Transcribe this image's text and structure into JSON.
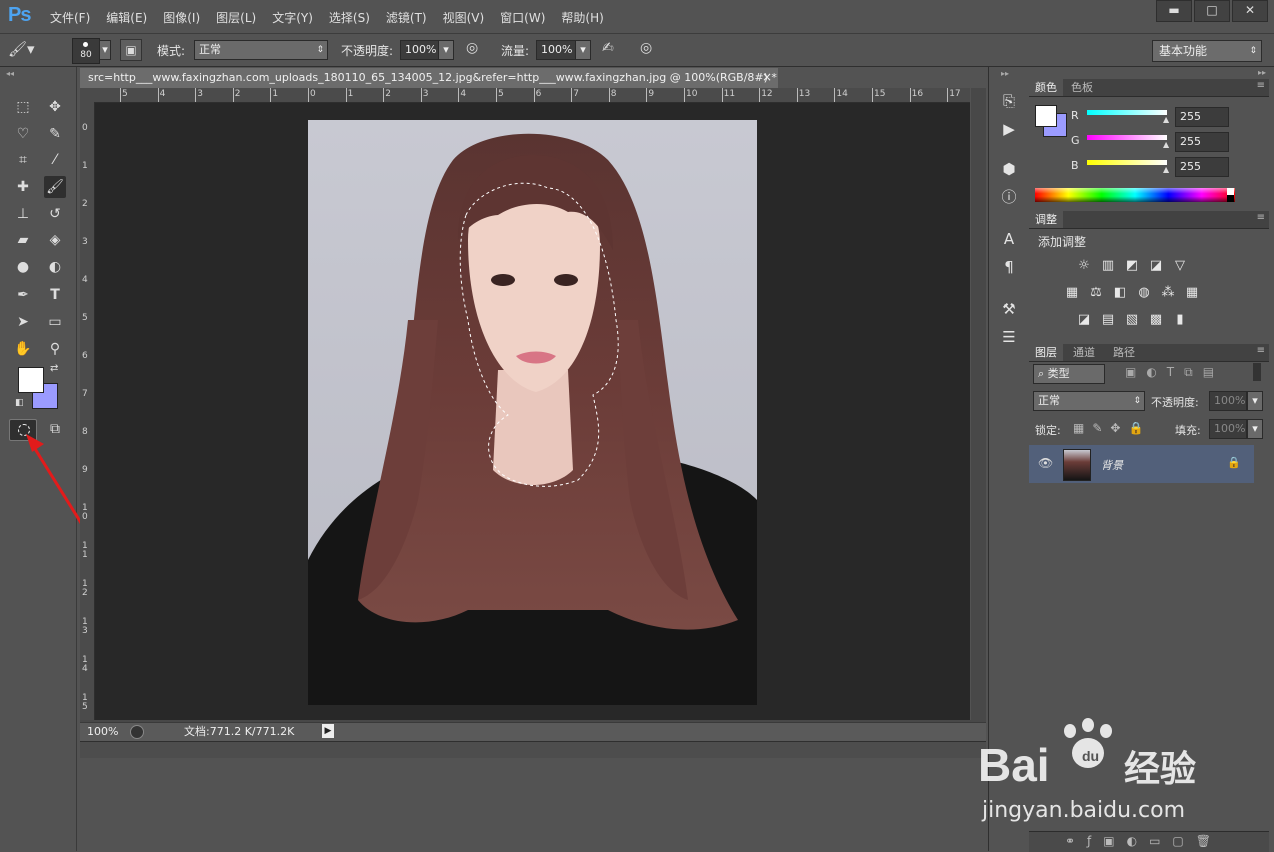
{
  "app": {
    "logo": "Ps"
  },
  "menu": [
    "文件(F)",
    "编辑(E)",
    "图像(I)",
    "图层(L)",
    "文字(Y)",
    "选择(S)",
    "滤镜(T)",
    "视图(V)",
    "窗口(W)",
    "帮助(H)"
  ],
  "window_buttons": {
    "minimize": "▬",
    "maximize": "□",
    "close": "✕"
  },
  "options": {
    "brush_size": "80",
    "mode_label": "模式:",
    "mode_value": "正常",
    "opacity_label": "不透明度:",
    "opacity_value": "100%",
    "flow_label": "流量:",
    "flow_value": "100%",
    "workspace": "基本功能"
  },
  "document": {
    "tab_title": "src=http___www.faxingzhan.com_uploads_180110_65_134005_12.jpg&refer=http___www.faxingzhan.jpg @ 100%(RGB/8#) *",
    "close": "×",
    "ruler_top": [
      "5",
      "4",
      "3",
      "2",
      "1",
      "0",
      "1",
      "2",
      "3",
      "4",
      "5",
      "6",
      "7",
      "8",
      "9",
      "10",
      "11",
      "12",
      "13",
      "14",
      "15",
      "16",
      "17"
    ],
    "ruler_left": [
      "0",
      "1",
      "2",
      "3",
      "4",
      "5",
      "6",
      "7",
      "8",
      "9",
      "1\n0",
      "1\n1",
      "1\n2",
      "1\n3",
      "1\n4",
      "1\n5"
    ],
    "zoom": "100%",
    "doc_info": "文档:771.2 K/771.2K"
  },
  "color_panel": {
    "tabs": [
      "颜色",
      "色板"
    ],
    "r_label": "R",
    "g_label": "G",
    "b_label": "B",
    "r": "255",
    "g": "255",
    "b": "255",
    "foreground": "#ffffff",
    "background": "#9b9bff"
  },
  "adjust_panel": {
    "tab": "调整",
    "title": "添加调整"
  },
  "layers_panel": {
    "tabs": [
      "图层",
      "通道",
      "路径"
    ],
    "filter": "类型",
    "blend": "正常",
    "opacity_label": "不透明度:",
    "opacity_value": "100%",
    "lock_label": "锁定:",
    "fill_label": "填充:",
    "fill_value": "100%",
    "layer_name": "背景"
  },
  "watermark": {
    "brand": "Bai",
    "brand2": "经验",
    "url": "jingyan.baidu.com"
  }
}
